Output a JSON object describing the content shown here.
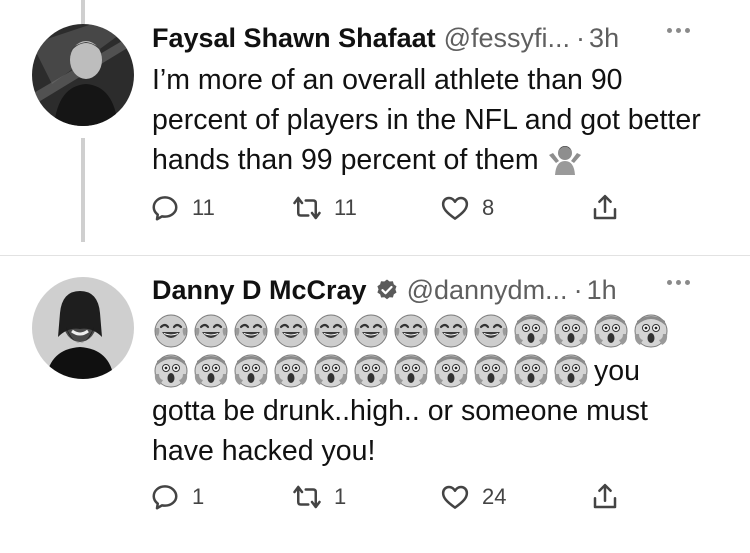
{
  "tweets": [
    {
      "name": "Faysal Shawn Shafaat",
      "handle": "@fessyfi...",
      "dot": "·",
      "time": "3h",
      "text": "I’m more of an overall athlete than 90 percent of players in the NFL and got better hands than 99 percent of them",
      "trailing_emoji": "person-shrugging-emoji",
      "replies": "11",
      "retweets": "11",
      "likes": "8"
    },
    {
      "name": "Danny D McCray",
      "verified": true,
      "handle": "@dannydm...",
      "dot": "·",
      "time": "1h",
      "emoji_row1": [
        "joy",
        "joy",
        "joy",
        "joy",
        "joy",
        "joy",
        "joy",
        "joy",
        "joy",
        "scream",
        "scream",
        "scream",
        "scream"
      ],
      "emoji_row2": [
        "scream",
        "scream",
        "scream",
        "scream",
        "scream",
        "scream",
        "scream",
        "scream",
        "scream",
        "scream",
        "scream"
      ],
      "text_after_emojis": "you",
      "text": "gotta be drunk..high.. or someone must have hacked you!",
      "replies": "1",
      "retweets": "1",
      "likes": "24"
    }
  ],
  "icons": {
    "reply": "reply-icon",
    "retweet": "retweet-icon",
    "like": "heart-icon",
    "share": "share-icon",
    "more": "more-icon",
    "verified": "verified-badge-icon"
  },
  "colors": {
    "text": "#111111",
    "muted": "#5f5f5f",
    "thread_line": "#cfcfcf"
  }
}
